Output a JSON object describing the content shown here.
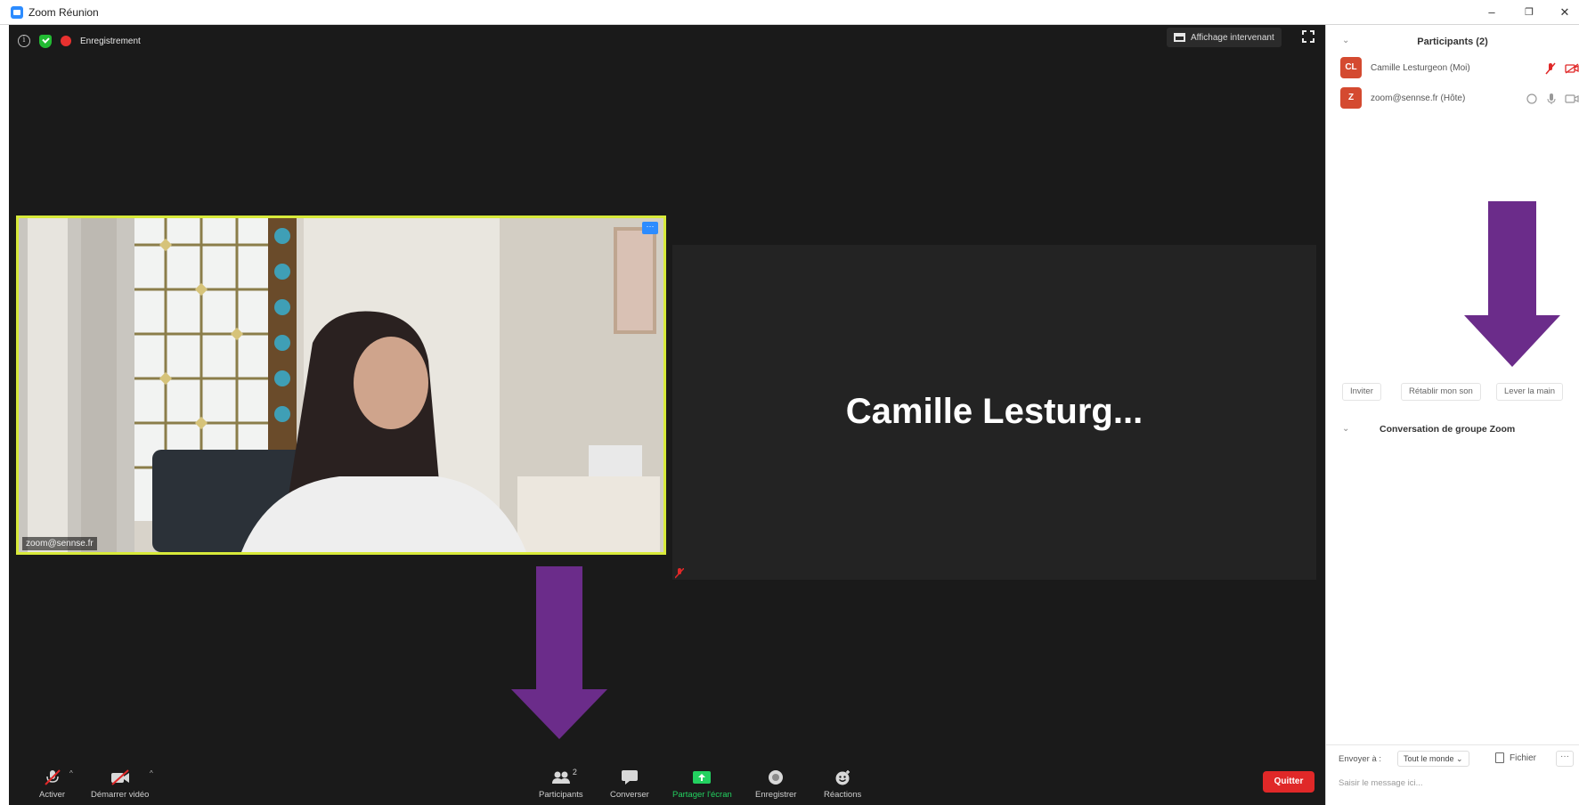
{
  "window": {
    "title": "Zoom Réunion",
    "minimize": "–",
    "restore": "❐",
    "close": "✕"
  },
  "meeting": {
    "recording_label": "Enregistrement",
    "speaker_view_label": "Affichage intervenant",
    "video_tile_name": "zoom@sennse.fr",
    "tile_menu": "···",
    "big_name": "Camille  Lesturg..."
  },
  "toolbar": {
    "mute_label": "Activer",
    "video_label": "Démarrer vidéo",
    "participants_label": "Participants",
    "participants_count": "2",
    "chat_label": "Converser",
    "share_label": "Partager l'écran",
    "record_label": "Enregistrer",
    "reactions_label": "Réactions",
    "quit_label": "Quitter",
    "caret": "^"
  },
  "panel": {
    "title": "Participants (2)",
    "participants": [
      {
        "initials": "CL",
        "name": "Camille Lesturgeon (Moi)"
      },
      {
        "initials": "Z",
        "name": "zoom@sennse.fr (Hôte)"
      }
    ],
    "actions": {
      "invite": "Inviter",
      "restore_sound": "Rétablir mon son",
      "raise_hand": "Lever la main"
    },
    "chat_title": "Conversation de groupe Zoom",
    "send_to_label": "Envoyer à :",
    "recipient": "Tout le monde ⌄",
    "file_label": "Fichier",
    "more": "···",
    "message_placeholder": "Saisir le message ici..."
  },
  "colors": {
    "meeting_bg": "#1a1a1a",
    "active_border": "#d8ea3a",
    "arrow": "#6b2c8a",
    "quit": "#e02828",
    "share_green": "#23d160",
    "avatar": "#d44a30"
  }
}
